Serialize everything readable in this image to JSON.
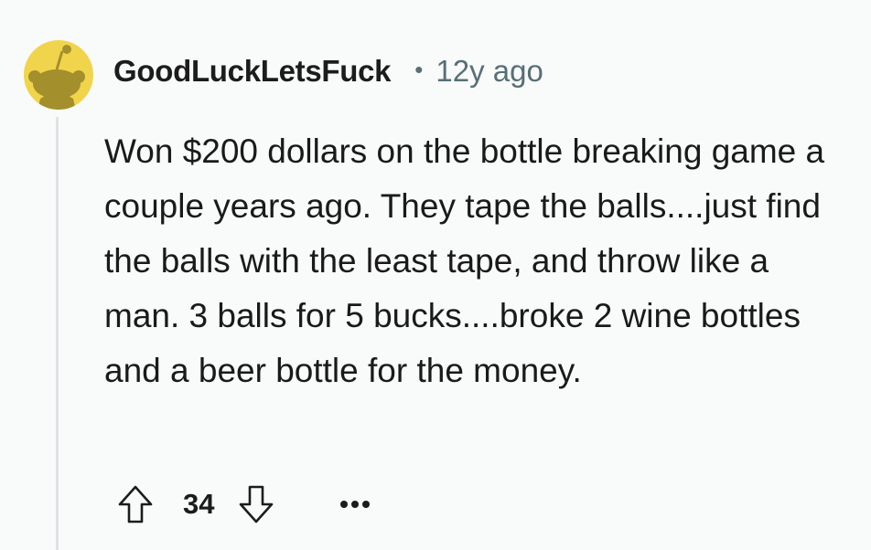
{
  "comment": {
    "author": "GoodLuckLetsFuck",
    "separator": "•",
    "time_ago": "12y ago",
    "body": "Won $200 dollars on the bottle breaking game a couple years ago. They tape the balls....just find the balls with the least tape, and throw like a man. 3 balls for 5 bucks....broke 2 wine bottles and a beer bottle for the money.",
    "score": "34",
    "avatar_icon": "reddit-snoo-avatar-icon",
    "avatar_color": "#f0d54c"
  },
  "actions": {
    "upvote_icon": "upvote-arrow-icon",
    "downvote_icon": "downvote-arrow-icon",
    "more_icon": "more-options-icon"
  }
}
